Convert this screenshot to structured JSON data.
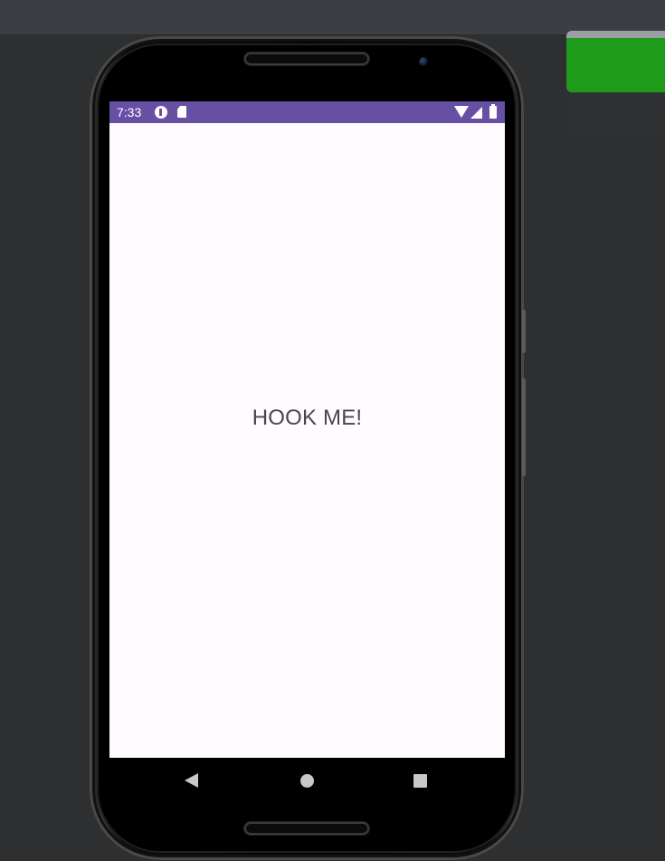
{
  "status_bar": {
    "time": "7:33",
    "icons": [
      "p-notification-icon",
      "sd-card-icon",
      "wifi-icon",
      "cell-signal-icon",
      "battery-icon"
    ],
    "background_color": "#6750a4"
  },
  "app": {
    "center_text": "HOOK ME!",
    "background_color": "#fffbfe",
    "text_color": "#49454f"
  },
  "nav_bar": {
    "buttons": [
      "back",
      "home",
      "recents"
    ]
  },
  "emulator": {
    "indicator_color": "#1e9b1b"
  }
}
